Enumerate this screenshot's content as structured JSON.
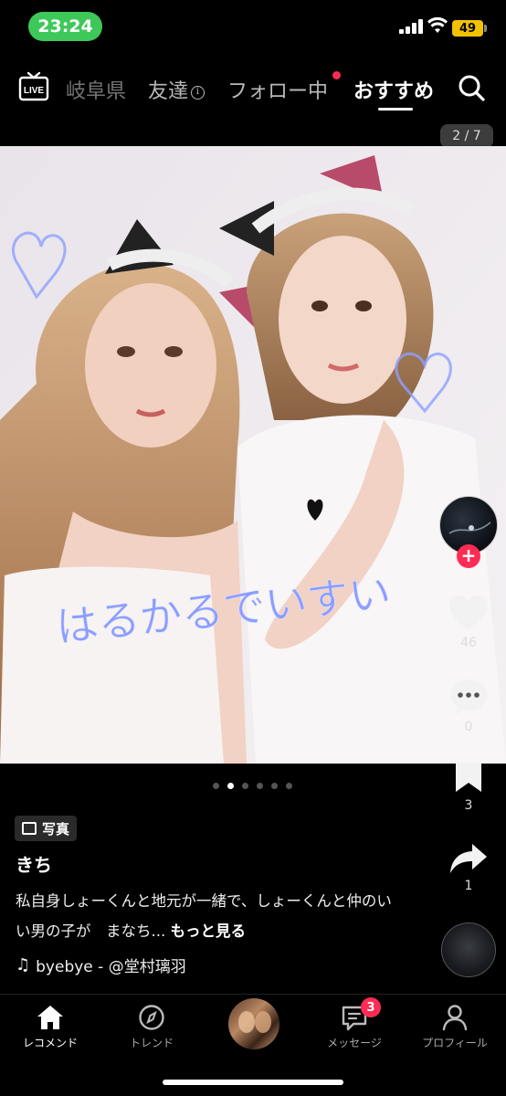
{
  "status_bar": {
    "time": "23:24",
    "battery": "49",
    "colors": {
      "time_pill": "#3ec85a",
      "battery": "#f2c200"
    }
  },
  "top_nav": {
    "live_label": "LIVE",
    "tabs": [
      {
        "label": "岐阜県"
      },
      {
        "label": "友達"
      },
      {
        "label": "フォロー中"
      },
      {
        "label": "おすすめ",
        "active": true
      }
    ],
    "search_icon": "search-icon"
  },
  "post": {
    "page_counter": "2 / 7",
    "photo_overlay_text": "はるかるでいすい",
    "carousel": {
      "count": 6,
      "active_index": 1
    },
    "type_badge": "写真",
    "username": "きち",
    "caption": "私自身しょーくんと地元が一緒で、しょーくんと仲のいい男の子が　まなち...",
    "more_label": "もっと見る",
    "music": "byebye - @堂村璃羽"
  },
  "actions": {
    "likes": "46",
    "comments": "0",
    "saves": "3",
    "shares": "1",
    "accent": "#fe2c55"
  },
  "bottom_nav": {
    "items": [
      {
        "label": "レコメンド",
        "icon": "home-icon",
        "active": true
      },
      {
        "label": "トレンド",
        "icon": "compass-icon"
      },
      {
        "label": "メッセージ",
        "icon": "message-icon",
        "badge": "3"
      },
      {
        "label": "プロフィール",
        "icon": "person-icon"
      }
    ]
  }
}
